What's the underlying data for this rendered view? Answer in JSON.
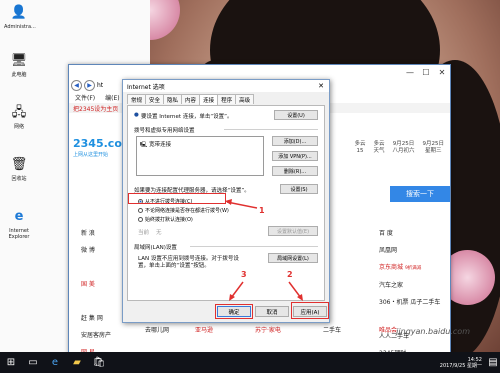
{
  "desktop": {
    "icons": [
      {
        "label": "Administra...",
        "glyph": "👤"
      },
      {
        "label": "此电脑",
        "glyph": "🖥"
      },
      {
        "label": "网络",
        "glyph": "🖧"
      },
      {
        "label": "回收站",
        "glyph": "🗑"
      },
      {
        "label": "Internet Explorer",
        "glyph": "e"
      }
    ]
  },
  "browser": {
    "url_fragment": "ht",
    "menu": [
      "文件(F)",
      "编(E)"
    ],
    "link_bar": "把2345设为主页",
    "logo": "2345.com",
    "logo_sub": "上网从这里开始",
    "weather": [
      {
        "line1": "多云",
        "line2": "15"
      },
      {
        "line1": "多云",
        "line2": "天气"
      },
      {
        "line1": "9月25日",
        "line2": "八月初六"
      },
      {
        "line1": "9月25日",
        "line2": "星期三"
      }
    ],
    "search_button": "搜索一下",
    "left_tabs": [
      "新 浪",
      "微 博",
      "",
      "国 美",
      "",
      "赶 集 网",
      "安居客房产",
      "网 易"
    ],
    "right_links": [
      {
        "a": "百 度",
        "b": ""
      },
      {
        "a": "凤凰网",
        "b": ""
      },
      {
        "a": "京东商城",
        "b": "9折满减"
      },
      {
        "a": "汽车之家",
        "b": ""
      },
      {
        "a": "306・机票",
        "b": "瓜子二手车"
      },
      {
        "a": "",
        "b": ""
      },
      {
        "a": "人人二手车",
        "b": ""
      },
      {
        "a": "2345理财",
        "b": ""
      },
      {
        "a": "唯品会",
        "b": ""
      }
    ],
    "bottom_row": [
      "去哪儿网",
      "亚马逊",
      "苏宁·家电",
      "二手车",
      "唯品会"
    ],
    "dialog": {
      "title": "Internet 选项",
      "close": "✕",
      "tabs": [
        "常规",
        "安全",
        "隐私",
        "内容",
        "连接",
        "程序",
        "高级"
      ],
      "active_tab": "连接",
      "setup_text": "要设置 Internet 连接，单击“设置”。",
      "setup_button": "设置(U)",
      "dialup_group": "拨号和虚拟专用网络设置",
      "connection_item": "宽带连接",
      "add_button": "添加(D)...",
      "add_vpn_button": "添加 VPN(P)...",
      "remove_button": "删除(R)...",
      "settings_button": "设置(S)",
      "proxy_text": "如果要为连接配置代理服务器，请选择“设置”。",
      "radios": [
        {
          "label": "从不进行拨号连接(C)",
          "checked": true
        },
        {
          "label": "不论网络连接是否存在都进行拨号(W)",
          "checked": false
        },
        {
          "label": "始终拨打默认连接(O)",
          "checked": false
        }
      ],
      "current_label": "当前",
      "current_value": "无",
      "default_button": "设置默认值(E)",
      "lan_group": "局域网(LAN)设置",
      "lan_text_1": "LAN 设置不应用到拨号连接。对于拨号设",
      "lan_text_2": "置，单击上面的“设置”按钮。",
      "lan_button": "局域网设置(L)",
      "ok_button": "确定",
      "cancel_button": "取消",
      "apply_button": "应用(A)",
      "annotations": [
        "1",
        "2",
        "3"
      ]
    }
  },
  "taskbar": {
    "time": "14:52",
    "date": "2017/9/25 星期一"
  },
  "watermark": "jingyan.baidu.com"
}
